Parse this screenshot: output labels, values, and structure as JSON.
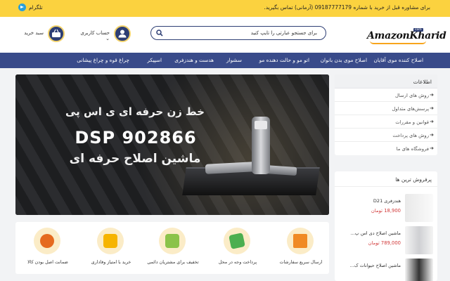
{
  "topbar": {
    "telegram_label": "تلگرام",
    "contact_message": "برای مشاوره قبل از خرید با شماره 09187777179 (آرمانی) تماس بگیرید."
  },
  "header": {
    "logo_text": "AmazonKharid",
    "logo_badge": "com",
    "search_placeholder": "برای جستجو عبارتی را تایپ کنید",
    "account_label": "حساب کاربری",
    "cart_label": "سبد خرید",
    "accent_color": "#2d3e74"
  },
  "nav": {
    "items": [
      "اصلاح کننده موی آقایان",
      "اصلاح موی بدن بانوان",
      "اتو مو و حالت دهنده مو",
      "سشوار",
      "هدست و هندزفری",
      "اسپیکر",
      "چراغ قوه و چراغ پیشانی"
    ]
  },
  "banner": {
    "line1": "خط زن حرفه ای ی اس پی",
    "line2": "DSP 902866",
    "line3": "ماشین اصلاح حرفه ای"
  },
  "features": [
    {
      "icon": "truck-icon",
      "label": "ارسال سریع سفارشات"
    },
    {
      "icon": "cash-on-delivery-icon",
      "label": "پرداخت وجه در محل"
    },
    {
      "icon": "discount-gift-icon",
      "label": "تخفیف برای مشتریان دائمی"
    },
    {
      "icon": "loyalty-points-icon",
      "label": "خرید با امتیاز وفاداری"
    },
    {
      "icon": "quality-medal-icon",
      "label": "ضمانت اصل بودن کالا"
    }
  ],
  "info": {
    "title": "اطلاعات",
    "links": [
      "روش های ارسال",
      "پرسش‌های متداول",
      "قوانین و مقررات",
      "روش های پرداخت",
      "فروشگاه های ما"
    ]
  },
  "bestsellers": {
    "title": "پرفروش ترین ها",
    "products": [
      {
        "name": "هندزفری D21",
        "price": "18,900",
        "currency": "تومان"
      },
      {
        "name": "ماشین اصلاح دی اس پ...",
        "price": "789,000",
        "currency": "تومان"
      },
      {
        "name": "ماشین اصلاح حیوانات ک...",
        "price": "",
        "currency": ""
      }
    ]
  }
}
